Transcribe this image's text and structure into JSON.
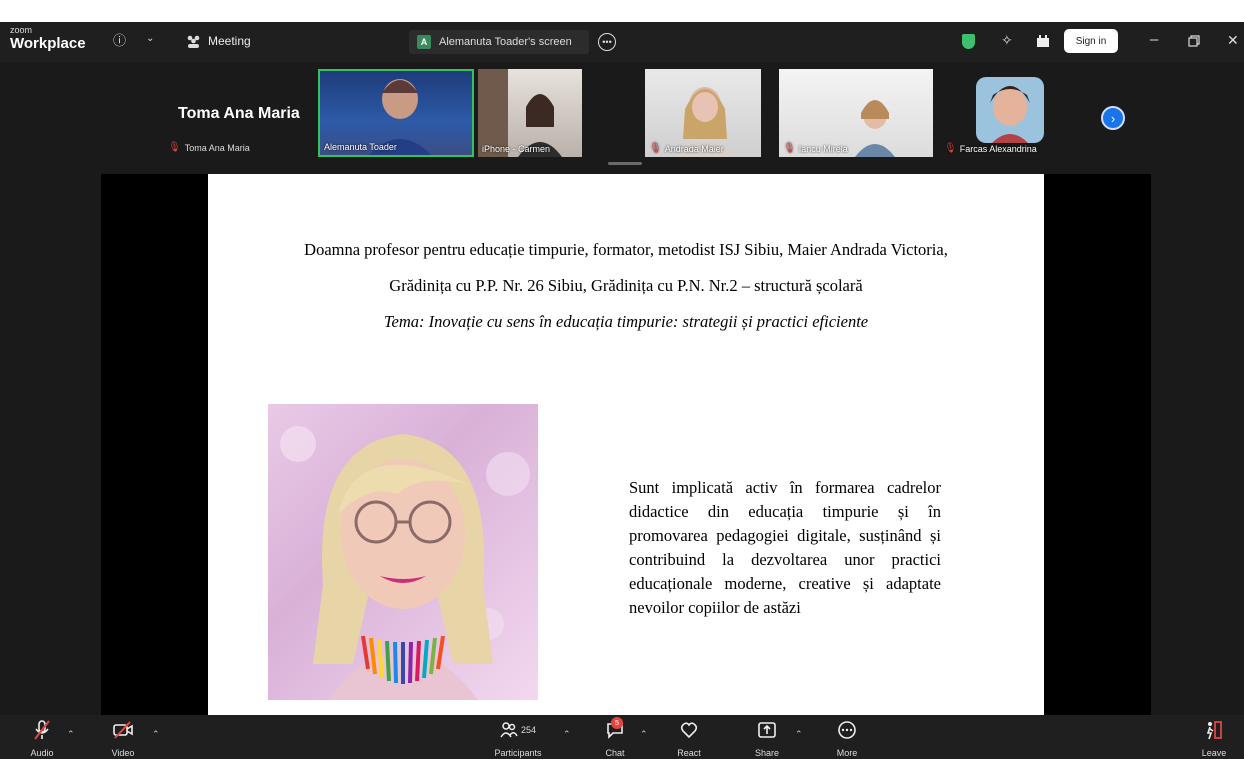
{
  "app": {
    "brand_small": "zoom",
    "brand_name": "Workplace",
    "meeting_label": "Meeting",
    "screen_badge": "A",
    "screen_tab_label": "Alemanuta Toader's screen",
    "sign_in_label": "Sign in"
  },
  "participants": {
    "active_name": "Toma Ana Maria",
    "active_subname": "Toma Ana Maria",
    "tiles": [
      {
        "label": "Alemanuta Toader",
        "muted": false,
        "speaking": true
      },
      {
        "label": "iPhone - Carmen",
        "muted": false,
        "speaking": false
      },
      {
        "label": "Andrada Maier",
        "muted": true,
        "speaking": false
      },
      {
        "label": "Iancu Mirela",
        "muted": true,
        "speaking": false
      },
      {
        "label": "Farcas Alexandrina",
        "muted": true,
        "speaking": false
      }
    ]
  },
  "slide": {
    "line1": "Doamna profesor pentru educație timpurie, formator, metodist ISJ Sibiu, Maier Andrada Victoria,",
    "line2": "Grădinița cu P.P. Nr. 26 Sibiu, Grădinița cu P.N. Nr.2 – structură școlară",
    "line3": "Tema: Inovație cu sens în educația timpurie: strategii și practici eficiente",
    "bio": "Sunt implicată activ în formarea cadrelor didactice din educația timpurie și în promovarea pedagogiei digitale, susținând și contribuind la dezvoltarea unor practici educaționale moderne, creative și adaptate nevoilor copiilor de astăzi"
  },
  "toolbar": {
    "audio_label": "Audio",
    "video_label": "Video",
    "participants_label": "Participants",
    "participants_count": "254",
    "chat_label": "Chat",
    "chat_badge": "5",
    "react_label": "React",
    "share_label": "Share",
    "more_label": "More",
    "leave_label": "Leave"
  },
  "colors": {
    "accent_blue": "#1a73e8",
    "speaking_green": "#34c15e",
    "mute_red": "#e04444"
  }
}
